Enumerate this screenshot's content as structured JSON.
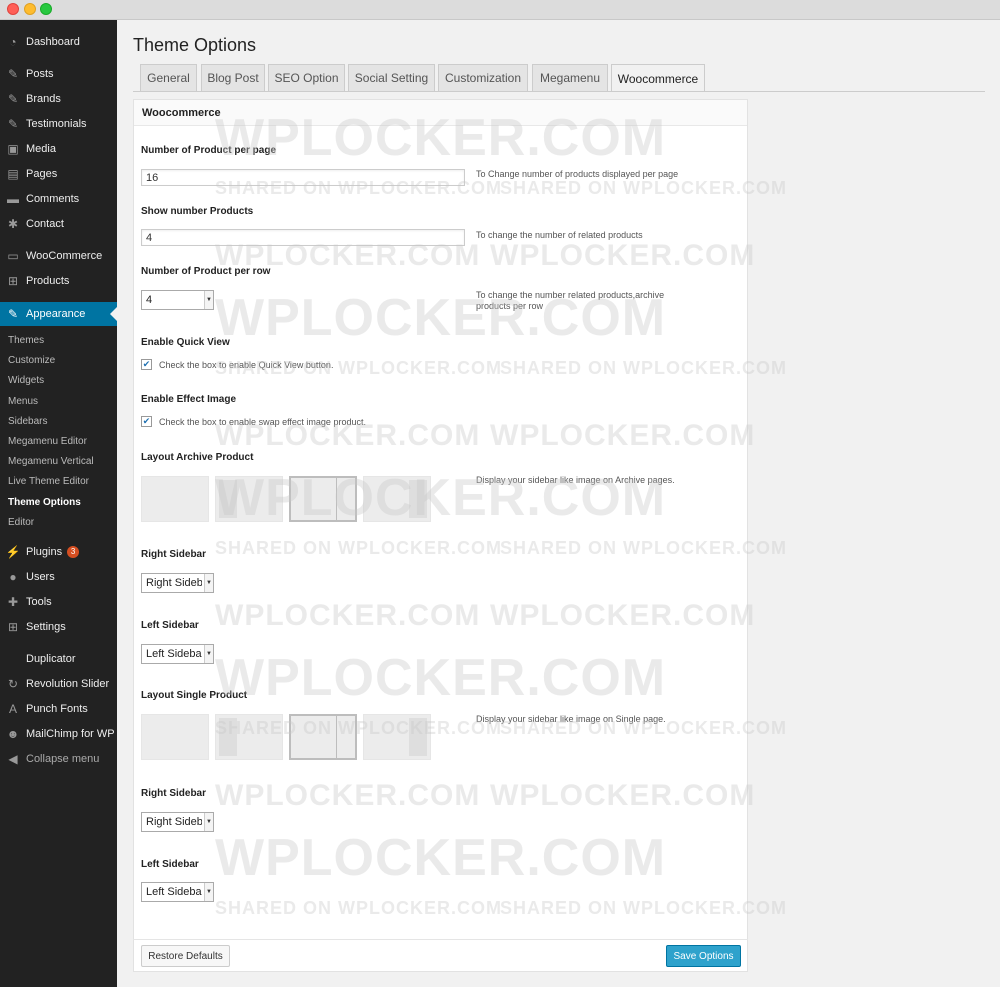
{
  "window": {
    "controls": [
      "close",
      "minimize",
      "zoom"
    ]
  },
  "sidebar": {
    "items": [
      {
        "label": "Dashboard",
        "icon": "dashboard-icon"
      },
      {
        "label": "Posts",
        "icon": "pin-icon"
      },
      {
        "label": "Brands",
        "icon": "pin-icon"
      },
      {
        "label": "Testimonials",
        "icon": "pin-icon"
      },
      {
        "label": "Media",
        "icon": "media-icon"
      },
      {
        "label": "Pages",
        "icon": "pages-icon"
      },
      {
        "label": "Comments",
        "icon": "comment-icon"
      },
      {
        "label": "Contact",
        "icon": "gear-icon"
      },
      {
        "label": "WooCommerce",
        "icon": "woo-icon"
      },
      {
        "label": "Products",
        "icon": "cart-icon"
      },
      {
        "label": "Appearance",
        "icon": "brush-icon"
      },
      {
        "label": "Plugins",
        "icon": "plug-icon",
        "badge": "3"
      },
      {
        "label": "Users",
        "icon": "user-icon"
      },
      {
        "label": "Tools",
        "icon": "wrench-icon"
      },
      {
        "label": "Settings",
        "icon": "settings-icon"
      },
      {
        "label": "Duplicator",
        "icon": "duplicator-icon"
      },
      {
        "label": "Revolution Slider",
        "icon": "refresh-icon"
      },
      {
        "label": "Punch Fonts",
        "icon": "font-icon"
      },
      {
        "label": "MailChimp for WP",
        "icon": "mailchimp-icon"
      },
      {
        "label": "Collapse menu",
        "icon": "collapse-icon"
      }
    ],
    "submenu": [
      "Themes",
      "Customize",
      "Widgets",
      "Menus",
      "Sidebars",
      "Megamenu Editor",
      "Megamenu Vertical",
      "Live Theme Editor",
      "Theme Options",
      "Editor"
    ]
  },
  "page": {
    "title": "Theme Options"
  },
  "tabs": [
    "General",
    "Blog Post",
    "SEO Option",
    "Social Setting",
    "Customization",
    "Megamenu",
    "Woocommerce"
  ],
  "panel": {
    "title": "Woocommerce",
    "products_per_page": {
      "label": "Number of Product per page",
      "value": "16",
      "desc": "To Change number of products displayed per page"
    },
    "show_number": {
      "label": "Show number Products",
      "value": "4",
      "desc": "To change the number of related products"
    },
    "per_row": {
      "label": "Number of Product per row",
      "value": "4",
      "desc": "To change the number related products,archive products per row"
    },
    "quick_view": {
      "label": "Enable Quick View",
      "check": "Check the box to enable Quick View button.",
      "checked": true
    },
    "effect_image": {
      "label": "Enable Effect Image",
      "check": "Check the box to enable swap effect image product.",
      "checked": true
    },
    "archive_layout": {
      "label": "Layout Archive Product",
      "desc": "Display your sidebar like image on Archive pages.",
      "selected": 2
    },
    "archive_right": {
      "label": "Right Sidebar",
      "value": "Right Sidebar"
    },
    "archive_left": {
      "label": "Left Sidebar",
      "value": "Left Sidebar"
    },
    "single_layout": {
      "label": "Layout Single Product",
      "desc": "Display your sidebar like image on Single page.",
      "selected": 2
    },
    "single_right": {
      "label": "Right Sidebar",
      "value": "Right Sidebar"
    },
    "single_left": {
      "label": "Left Sidebar",
      "value": "Left Sidebar"
    }
  },
  "buttons": {
    "restore": "Restore Defaults",
    "save": "Save Options"
  },
  "watermark": {
    "big": "WPLOCKER.COM",
    "small": "SHARED ON WPLOCKER.COM"
  },
  "colors": {
    "sidebar_bg": "#222222",
    "active": "#0074a2",
    "save": "#2ea2cc",
    "badge": "#d54e21"
  }
}
